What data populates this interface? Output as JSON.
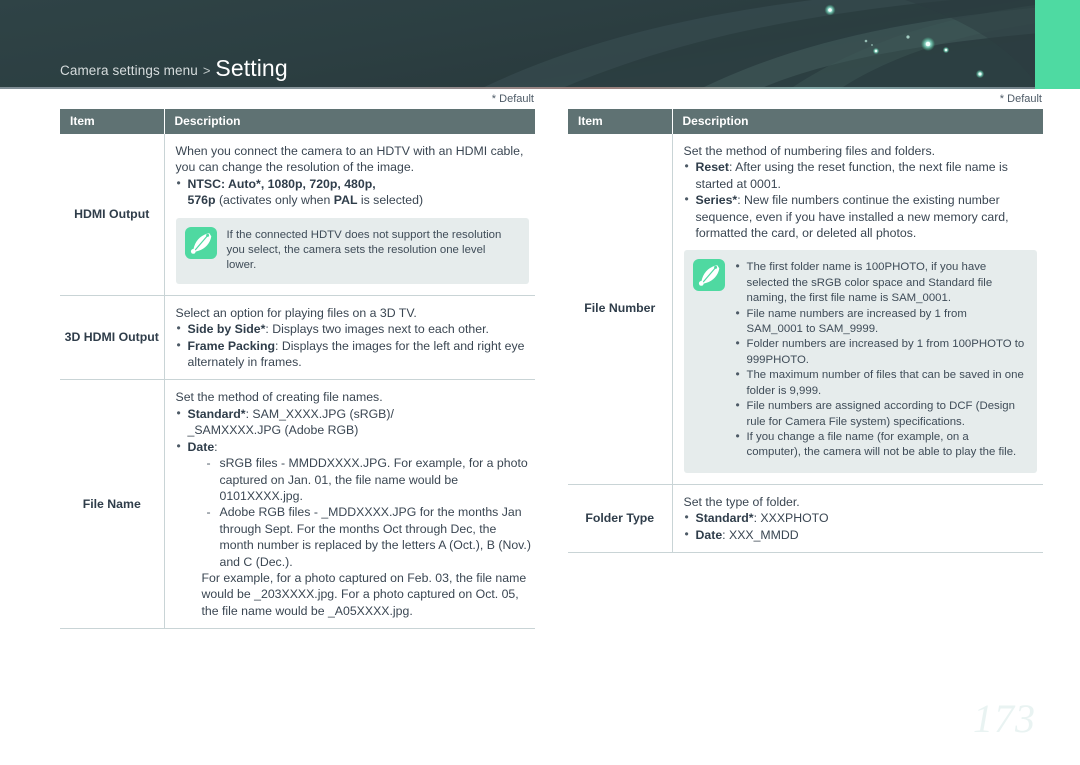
{
  "header": {
    "breadcrumb_path": "Camera settings menu",
    "separator": ">",
    "title": "Setting",
    "accent_dark": "#2e4144",
    "accent_green": "#4edaa2"
  },
  "page_number": "173",
  "table_header": {
    "item": "Item",
    "description": "Description",
    "default_note": "* Default",
    "header_bg": "#5f7273"
  },
  "left_column": {
    "rows": {
      "hdmi_output": {
        "item": "HDMI Output",
        "lead": "When you connect the camera to an HDTV with an HDMI cable, you can change the resolution of the image.",
        "bullet_ntsc_label": "NTSC: Auto*",
        "bullet_ntsc_rest": ", 1080p, 720p, 480p,",
        "bullet_ntsc_line2_bold": "576p",
        "bullet_ntsc_line2_mid": " (activates only when ",
        "bullet_ntsc_line2_bold2": "PAL",
        "bullet_ntsc_line2_end": " is selected)",
        "note": "If the connected HDTV does not support the resolution you select, the camera sets the resolution one level lower."
      },
      "hdmi_3d": {
        "item": "3D HDMI Output",
        "lead": "Select an option for playing files on a 3D TV.",
        "bullet1_label": "Side by Side*",
        "bullet1_text": ": Displays two images next to each other.",
        "bullet2_label": "Frame Packing",
        "bullet2_text": ": Displays the images for the left and right eye alternately in frames."
      },
      "file_name": {
        "item": "File Name",
        "lead": "Set the method of creating file names.",
        "bullet_standard_label": "Standard*",
        "bullet_standard_text": ": SAM_XXXX.JPG (sRGB)/",
        "bullet_standard_line2": "_SAMXXXX.JPG (Adobe RGB)",
        "bullet_date_label": "Date",
        "bullet_date_colon": ":",
        "dash1": "sRGB files - MMDDXXXX.JPG. For example, for a photo captured on Jan. 01, the file name would be 0101XXXX.jpg.",
        "dash2": "Adobe RGB files - _MDDXXXX.JPG for the months Jan through Sept. For the months Oct through Dec, the month number is replaced by the letters A (Oct.), B (Nov.) and C (Dec.).",
        "dash2_cont": "For example, for a photo captured on Feb. 03, the file name would be _203XXXX.jpg. For a photo captured on Oct. 05, the file name would be _A05XXXX.jpg."
      }
    }
  },
  "right_column": {
    "rows": {
      "file_number": {
        "item": "File Number",
        "lead": "Set the method of numbering files and folders.",
        "bullet_reset_label": "Reset",
        "bullet_reset_text": ": After using the reset function, the next file name is started at 0001.",
        "bullet_series_label": "Series*",
        "bullet_series_text": ": New file numbers continue the existing number sequence, even if you have installed a new memory card, formatted the card, or deleted all photos.",
        "note_items": [
          "The first folder name is 100PHOTO, if you have selected the sRGB color space and Standard file naming, the first file name is SAM_0001.",
          "File name numbers are increased by 1 from SAM_0001 to SAM_9999.",
          "Folder numbers are increased by 1 from 100PHOTO to 999PHOTO.",
          "The maximum number of files that can be saved in one folder is 9,999.",
          "File numbers are assigned according to DCF (Design rule for Camera File system) specifications.",
          "If you change a file name (for example, on a computer), the camera will not be able to play the file."
        ]
      },
      "folder_type": {
        "item": "Folder Type",
        "lead": "Set the type of folder.",
        "bullet1_label": "Standard*",
        "bullet1_text": ": XXXPHOTO",
        "bullet2_label": "Date",
        "bullet2_text": ": XXX_MMDD"
      }
    }
  }
}
